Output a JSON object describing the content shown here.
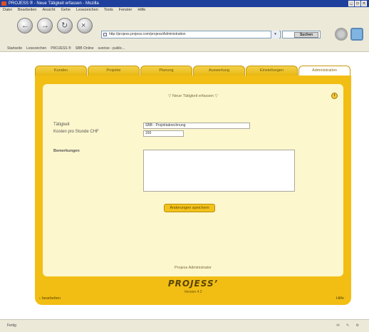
{
  "window": {
    "title": "PROJESS ® - Neue Tätigkeit erfassen - Mozilla",
    "controls": [
      "_",
      "□",
      "×"
    ]
  },
  "menu": [
    "Datei",
    "Bearbeiten",
    "Ansicht",
    "Gehe",
    "Lesezeichen",
    "Tools",
    "Fenster",
    "Hilfe"
  ],
  "toolbar": {
    "back_icon": "←",
    "forward_icon": "→",
    "reload_icon": "↻",
    "stop_icon": "×",
    "url": "http://projess.projess.com/projess/Administration",
    "dropdown_arrow": "▾",
    "search_label": "Suchen"
  },
  "bookmarks": [
    "Startseite",
    "Lesezeichen",
    "PROJESS ®",
    "SBB Online",
    "sunrise - public..."
  ],
  "tabs": [
    {
      "label": "Kunden",
      "active": false
    },
    {
      "label": "Projekte",
      "active": false
    },
    {
      "label": "Planung",
      "active": false
    },
    {
      "label": "Auswertung",
      "active": false
    },
    {
      "label": "Einstellungen",
      "active": false
    },
    {
      "label": "Administration",
      "active": true
    }
  ],
  "form": {
    "title": "▽ Neue Tätigkeit erfassen ▽",
    "info_icon_glyph": "i",
    "taetigkeit_label": "Tätigkeit",
    "taetigkeit_value": "SBB - Projektabrechnung",
    "kosten_label": "Kosten pro Stunde CHF",
    "kosten_value": "150",
    "bemerkungen_label": "Bemerkungen",
    "bemerkungen_value": "",
    "save_label": "Änderungen speichern"
  },
  "footer": {
    "admin_text": "Projess Administrator",
    "logo_text": "PROJESS’",
    "version": "Version 4.2",
    "back_link": "bearbeiten",
    "back_chevron": "‹",
    "help_link": "Hilfe"
  },
  "statusbar": {
    "text": "Fertig",
    "icons": "✉ ✎ ⚙"
  }
}
